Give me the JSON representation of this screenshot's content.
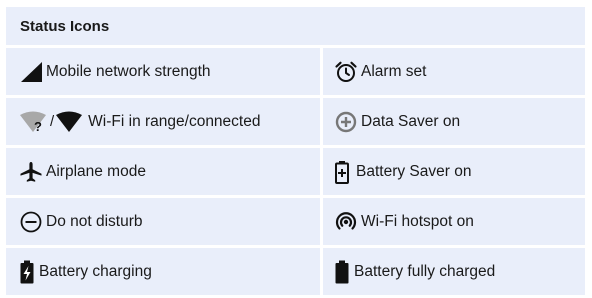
{
  "header": {
    "title": "Status Icons"
  },
  "rows": [
    {
      "left": {
        "icon": "mobile-signal-icon",
        "label": "Mobile network strength"
      },
      "right": {
        "icon": "alarm-clock-icon",
        "label": "Alarm set"
      }
    },
    {
      "left": {
        "icon": "wifi-icons",
        "icon_separator": "/",
        "label": "Wi-Fi in range/connected"
      },
      "right": {
        "icon": "data-saver-icon",
        "label": "Data Saver on"
      }
    },
    {
      "left": {
        "icon": "airplane-icon",
        "label": "Airplane mode"
      },
      "right": {
        "icon": "battery-saver-icon",
        "label": "Battery Saver on"
      }
    },
    {
      "left": {
        "icon": "do-not-disturb-icon",
        "label": "Do not disturb"
      },
      "right": {
        "icon": "hotspot-icon",
        "label": "Wi-Fi hotspot on"
      }
    },
    {
      "left": {
        "icon": "battery-charging-icon",
        "label": "Battery charging"
      },
      "right": {
        "icon": "battery-full-icon",
        "label": "Battery fully charged"
      }
    }
  ]
}
